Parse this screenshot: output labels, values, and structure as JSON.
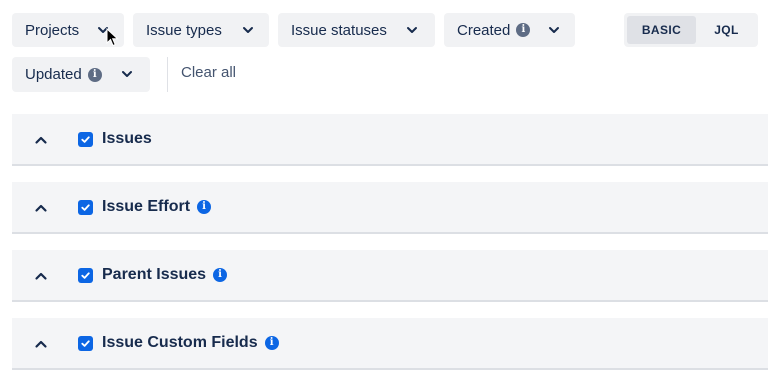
{
  "filters": [
    {
      "label": "Projects",
      "info": false,
      "icon": "chevron-down-icon"
    },
    {
      "label": "Issue types",
      "info": false,
      "icon": "chevron-down-icon"
    },
    {
      "label": "Issue statuses",
      "info": false,
      "icon": "chevron-down-icon"
    },
    {
      "label": "Created",
      "info": true,
      "icon": "chevron-down-icon"
    },
    {
      "label": "Updated",
      "info": true,
      "icon": "chevron-down-icon"
    }
  ],
  "mode": {
    "options": [
      "BASIC",
      "JQL"
    ],
    "selected": "BASIC"
  },
  "clear_all": "Clear all",
  "info_glyph": "i",
  "sections": [
    {
      "title": "Issues",
      "checked": true,
      "info": false,
      "expanded": true
    },
    {
      "title": "Issue Effort",
      "checked": true,
      "info": true,
      "expanded": true
    },
    {
      "title": "Parent Issues",
      "checked": true,
      "info": true,
      "expanded": true
    },
    {
      "title": "Issue Custom Fields",
      "checked": true,
      "info": true,
      "expanded": true
    }
  ],
  "colors": {
    "accent": "#0c66e4",
    "button_bg": "#f1f2f4",
    "section_bg": "#f4f5f7",
    "text": "#172b4d"
  }
}
